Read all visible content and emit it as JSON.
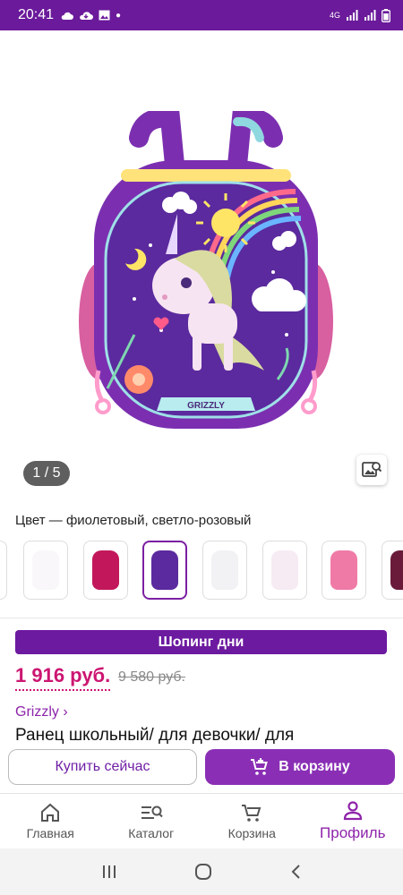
{
  "status_bar": {
    "time": "20:41",
    "left_icons": [
      "cloud-icon",
      "cloud-download-icon",
      "image-icon",
      "dot-icon"
    ],
    "network": "4G",
    "right_icons": [
      "signal-icon",
      "signal-icon",
      "battery-icon"
    ]
  },
  "gallery": {
    "counter": "1 / 5",
    "search_photo_icon": "image-search-icon"
  },
  "product": {
    "color_label": "Цвет — фиолетовый, светло-розовый",
    "promo_banner": "Шопинг дни",
    "price": "1 916 руб.",
    "old_price": "9 580 руб.",
    "brand": "Grizzly ›",
    "title": "Ранец школьный/ для девочки/ для"
  },
  "variants": [
    {
      "color": "#ece6f0",
      "faded": true
    },
    {
      "color": "#f0e8f2",
      "faded": true
    },
    {
      "color": "#c2185b",
      "faded": false
    },
    {
      "color": "#5b2a9e",
      "faded": false,
      "selected": true
    },
    {
      "color": "#d9d7e0",
      "faded": true
    },
    {
      "color": "#e6c6de",
      "faded": true
    },
    {
      "color": "#f07aa6",
      "faded": false
    },
    {
      "color": "#6a1b3a",
      "faded": false
    }
  ],
  "actions": {
    "buy_now": "Купить сейчас",
    "add_to_cart": "В корзину"
  },
  "tabs": [
    {
      "label": "Главная",
      "icon": "home-icon"
    },
    {
      "label": "Каталог",
      "icon": "catalog-search-icon"
    },
    {
      "label": "Корзина",
      "icon": "cart-icon"
    },
    {
      "label": "Профиль",
      "icon": "profile-icon",
      "active": true
    }
  ],
  "colors": {
    "accent": "#6c1aa0",
    "price": "#cc1672",
    "brand": "#8e24aa"
  }
}
